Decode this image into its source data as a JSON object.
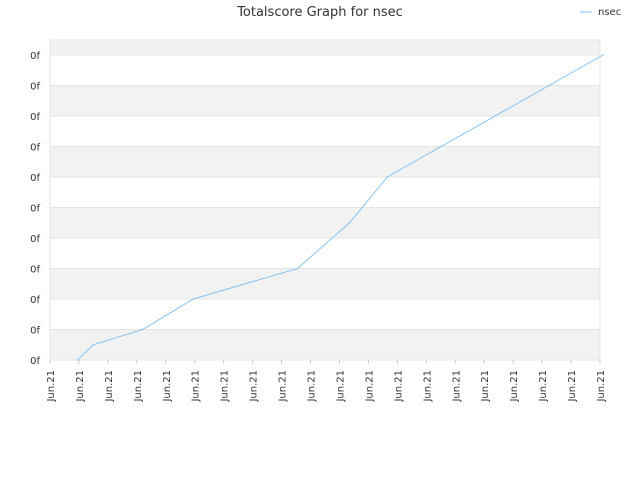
{
  "chart_data": {
    "type": "line",
    "title": "Totalscore Graph for nsec",
    "xlabel": "",
    "ylabel": "",
    "legend_position": "top-right",
    "grid": true,
    "band_colors": [
      "#f2f2f2",
      "#ffffff"
    ],
    "line_color": "#88c4f0",
    "y_tick_labels": [
      "0f",
      "0f",
      "0f",
      "0f",
      "0f",
      "0f",
      "0f",
      "0f",
      "0f",
      "0f",
      "0f"
    ],
    "x_tick_labels": [
      "Jun.21",
      "Jun.21",
      "Jun.21",
      "Jun.21",
      "Jun.21",
      "Jun.21",
      "Jun.21",
      "Jun.21",
      "Jun.21",
      "Jun.21",
      "Jun.21",
      "Jun.21",
      "Jun.21",
      "Jun.21",
      "Jun.21",
      "Jun.21",
      "Jun.21",
      "Jun.21",
      "Jun.21",
      "Jun.21"
    ],
    "ylim": [
      0,
      10
    ],
    "series": [
      {
        "name": "nsec",
        "x": [
          0.95,
          1.5,
          3.2,
          4.95,
          8.55,
          10.35,
          11.65,
          19.1
        ],
        "y": [
          0,
          0.5,
          1,
          2,
          3,
          4.5,
          6,
          10
        ]
      }
    ]
  }
}
